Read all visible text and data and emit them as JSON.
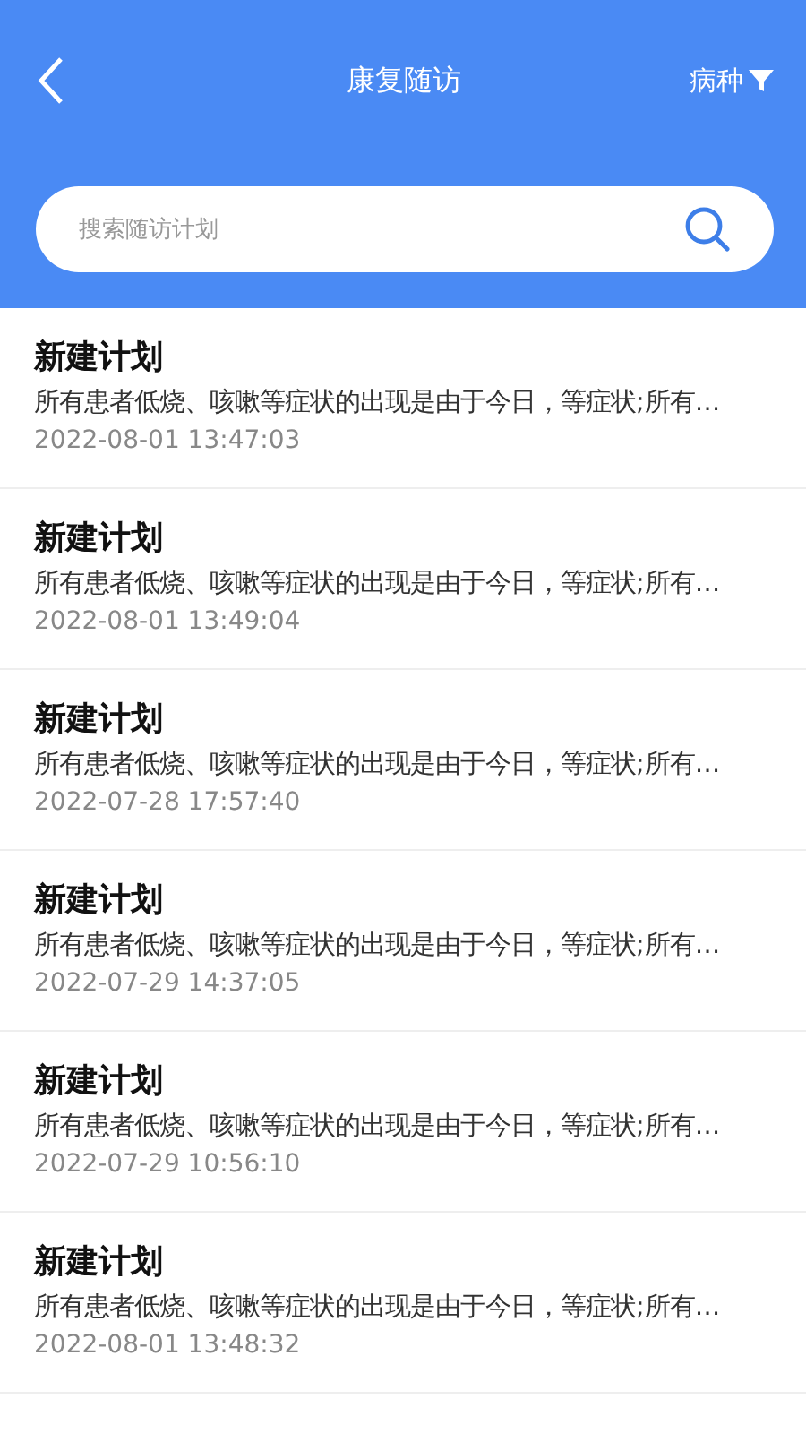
{
  "header": {
    "title": "康复随访",
    "filter_label": "病种"
  },
  "search": {
    "placeholder": "搜索随访计划"
  },
  "plans": [
    {
      "title": "新建计划",
      "description": "所有患者低烧、咳嗽等症状的出现是由于今日，等症状;所有…",
      "time": "2022-08-01 13:47:03"
    },
    {
      "title": "新建计划",
      "description": "所有患者低烧、咳嗽等症状的出现是由于今日，等症状;所有…",
      "time": "2022-08-01 13:49:04"
    },
    {
      "title": "新建计划",
      "description": "所有患者低烧、咳嗽等症状的出现是由于今日，等症状;所有…",
      "time": "2022-07-28 17:57:40"
    },
    {
      "title": "新建计划",
      "description": "所有患者低烧、咳嗽等症状的出现是由于今日，等症状;所有…",
      "time": "2022-07-29 14:37:05"
    },
    {
      "title": "新建计划",
      "description": "所有患者低烧、咳嗽等症状的出现是由于今日，等症状;所有…",
      "time": "2022-07-29 10:56:10"
    },
    {
      "title": "新建计划",
      "description": "所有患者低烧、咳嗽等症状的出现是由于今日，等症状;所有…",
      "time": "2022-08-01 13:48:32"
    }
  ]
}
